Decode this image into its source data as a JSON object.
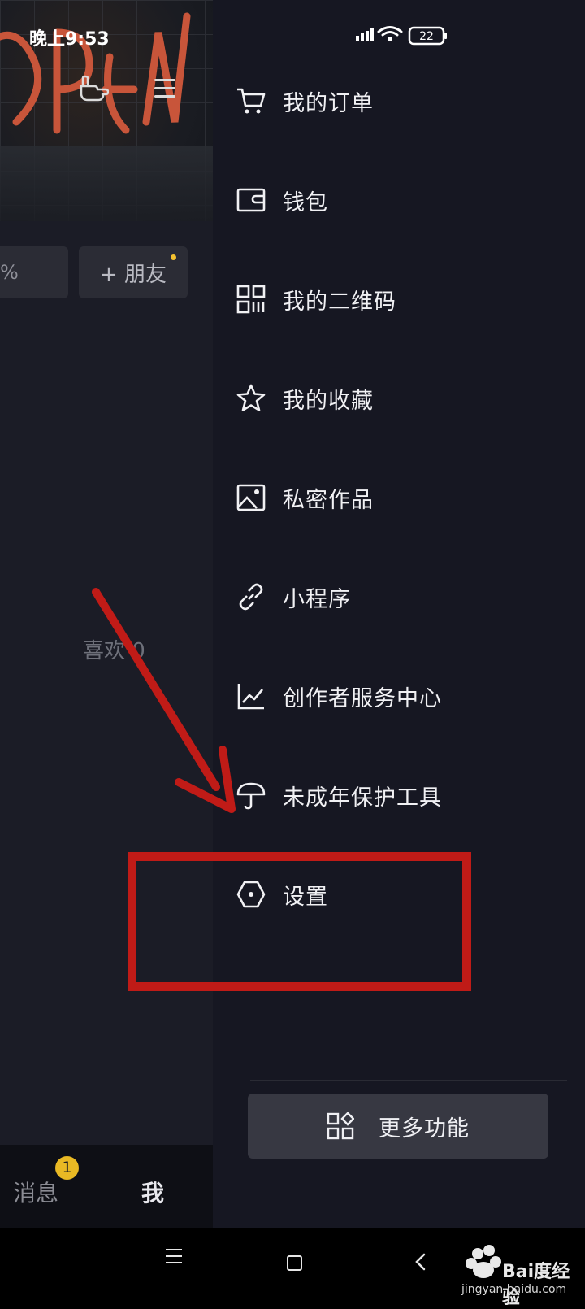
{
  "status_bar": {
    "time": "晚上9:53",
    "battery": "22"
  },
  "profile_bg": {
    "left_pill_text": "%",
    "add_friend_label": "+ 朋友",
    "likes_label": "喜欢 0",
    "nav": {
      "messages_label": "消息",
      "messages_badge": "1",
      "me_label": "我"
    }
  },
  "drawer": {
    "items": [
      {
        "label": "我的订单",
        "icon": "cart-icon"
      },
      {
        "label": "钱包",
        "icon": "wallet-icon"
      },
      {
        "label": "我的二维码",
        "icon": "qr-code-icon"
      },
      {
        "label": "我的收藏",
        "icon": "star-icon"
      },
      {
        "label": "私密作品",
        "icon": "image-icon"
      },
      {
        "label": "小程序",
        "icon": "link-icon"
      },
      {
        "label": "创作者服务中心",
        "icon": "chart-icon"
      },
      {
        "label": "未成年保护工具",
        "icon": "umbrella-icon"
      },
      {
        "label": "设置",
        "icon": "hexagon-settings-icon"
      }
    ],
    "more_label": "更多功能"
  },
  "annotation": {
    "highlight_color": "#c01b17"
  },
  "watermark": {
    "brand": "Bai度经验",
    "url": "jingyan.baidu.com"
  },
  "colors": {
    "background": "#161722",
    "button": "#373842",
    "badge": "#e9b924"
  }
}
